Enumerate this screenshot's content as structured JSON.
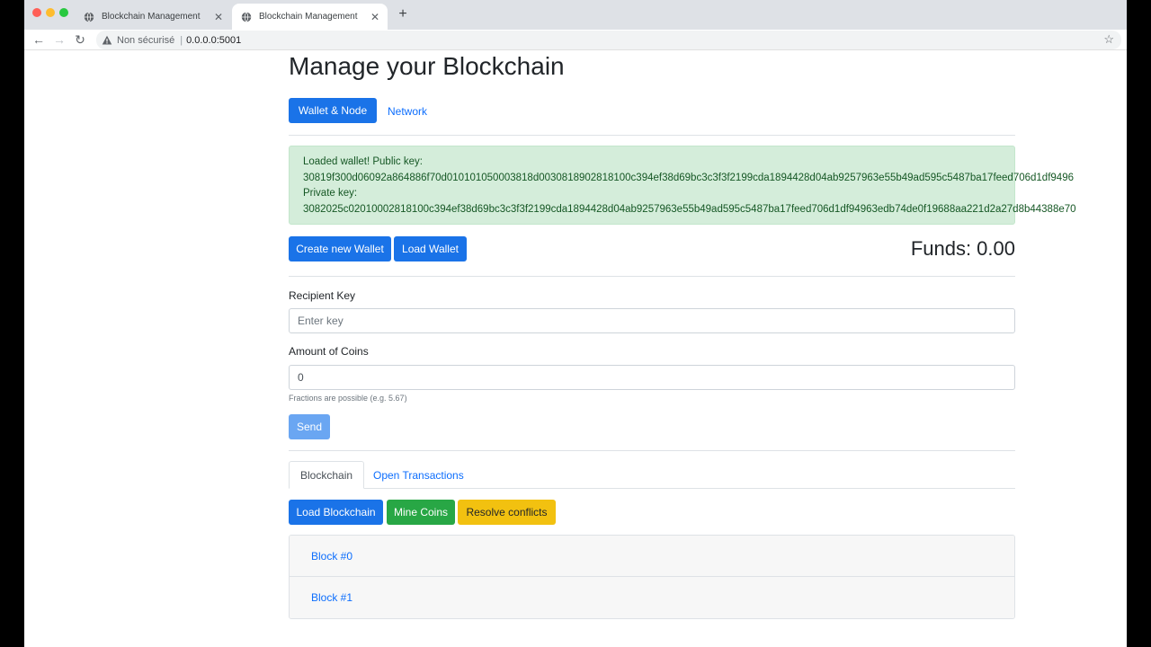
{
  "browser": {
    "tabs": [
      {
        "title": "Blockchain Management",
        "active": false
      },
      {
        "title": "Blockchain Management",
        "active": true
      }
    ],
    "security_label": "Non sécurisé",
    "url": "0.0.0.0:5001",
    "new_tab_symbol": "+",
    "close_symbol": "✕"
  },
  "page": {
    "title": "Manage your Blockchain",
    "nav": {
      "wallet_node": "Wallet & Node",
      "network": "Network"
    },
    "alert": {
      "line1": "Loaded wallet! Public key:",
      "public_key": "30819f300d06092a864886f70d010101050003818d0030818902818100c394ef38d69bc3c3f3f2199cda1894428d04ab9257963e55b49ad595c5487ba17feed706d1df9496",
      "line3": "Private key:",
      "private_key": "3082025c02010002818100c394ef38d69bc3c3f3f2199cda1894428d04ab9257963e55b49ad595c5487ba17feed706d1df94963edb74de0f19688aa221d2a27d8b44388e70"
    },
    "wallet_buttons": {
      "create": "Create new Wallet",
      "load": "Load Wallet"
    },
    "funds": "Funds: 0.00",
    "form": {
      "recipient_label": "Recipient Key",
      "recipient_placeholder": "Enter key",
      "amount_label": "Amount of Coins",
      "amount_value": "0",
      "hint": "Fractions are possible (e.g. 5.67)",
      "send": "Send"
    },
    "tabs": {
      "blockchain": "Blockchain",
      "open_transactions": "Open Transactions"
    },
    "actions": {
      "load_blockchain": "Load Blockchain",
      "mine": "Mine Coins",
      "resolve": "Resolve conflicts"
    },
    "blocks": [
      {
        "label": "Block #0"
      },
      {
        "label": "Block #1"
      }
    ]
  },
  "colors": {
    "primary": "#1a73e8",
    "success": "#28a745",
    "warning": "#f2c110",
    "alert_bg": "#d4edda",
    "alert_text": "#155724",
    "link": "#0d6efd"
  }
}
